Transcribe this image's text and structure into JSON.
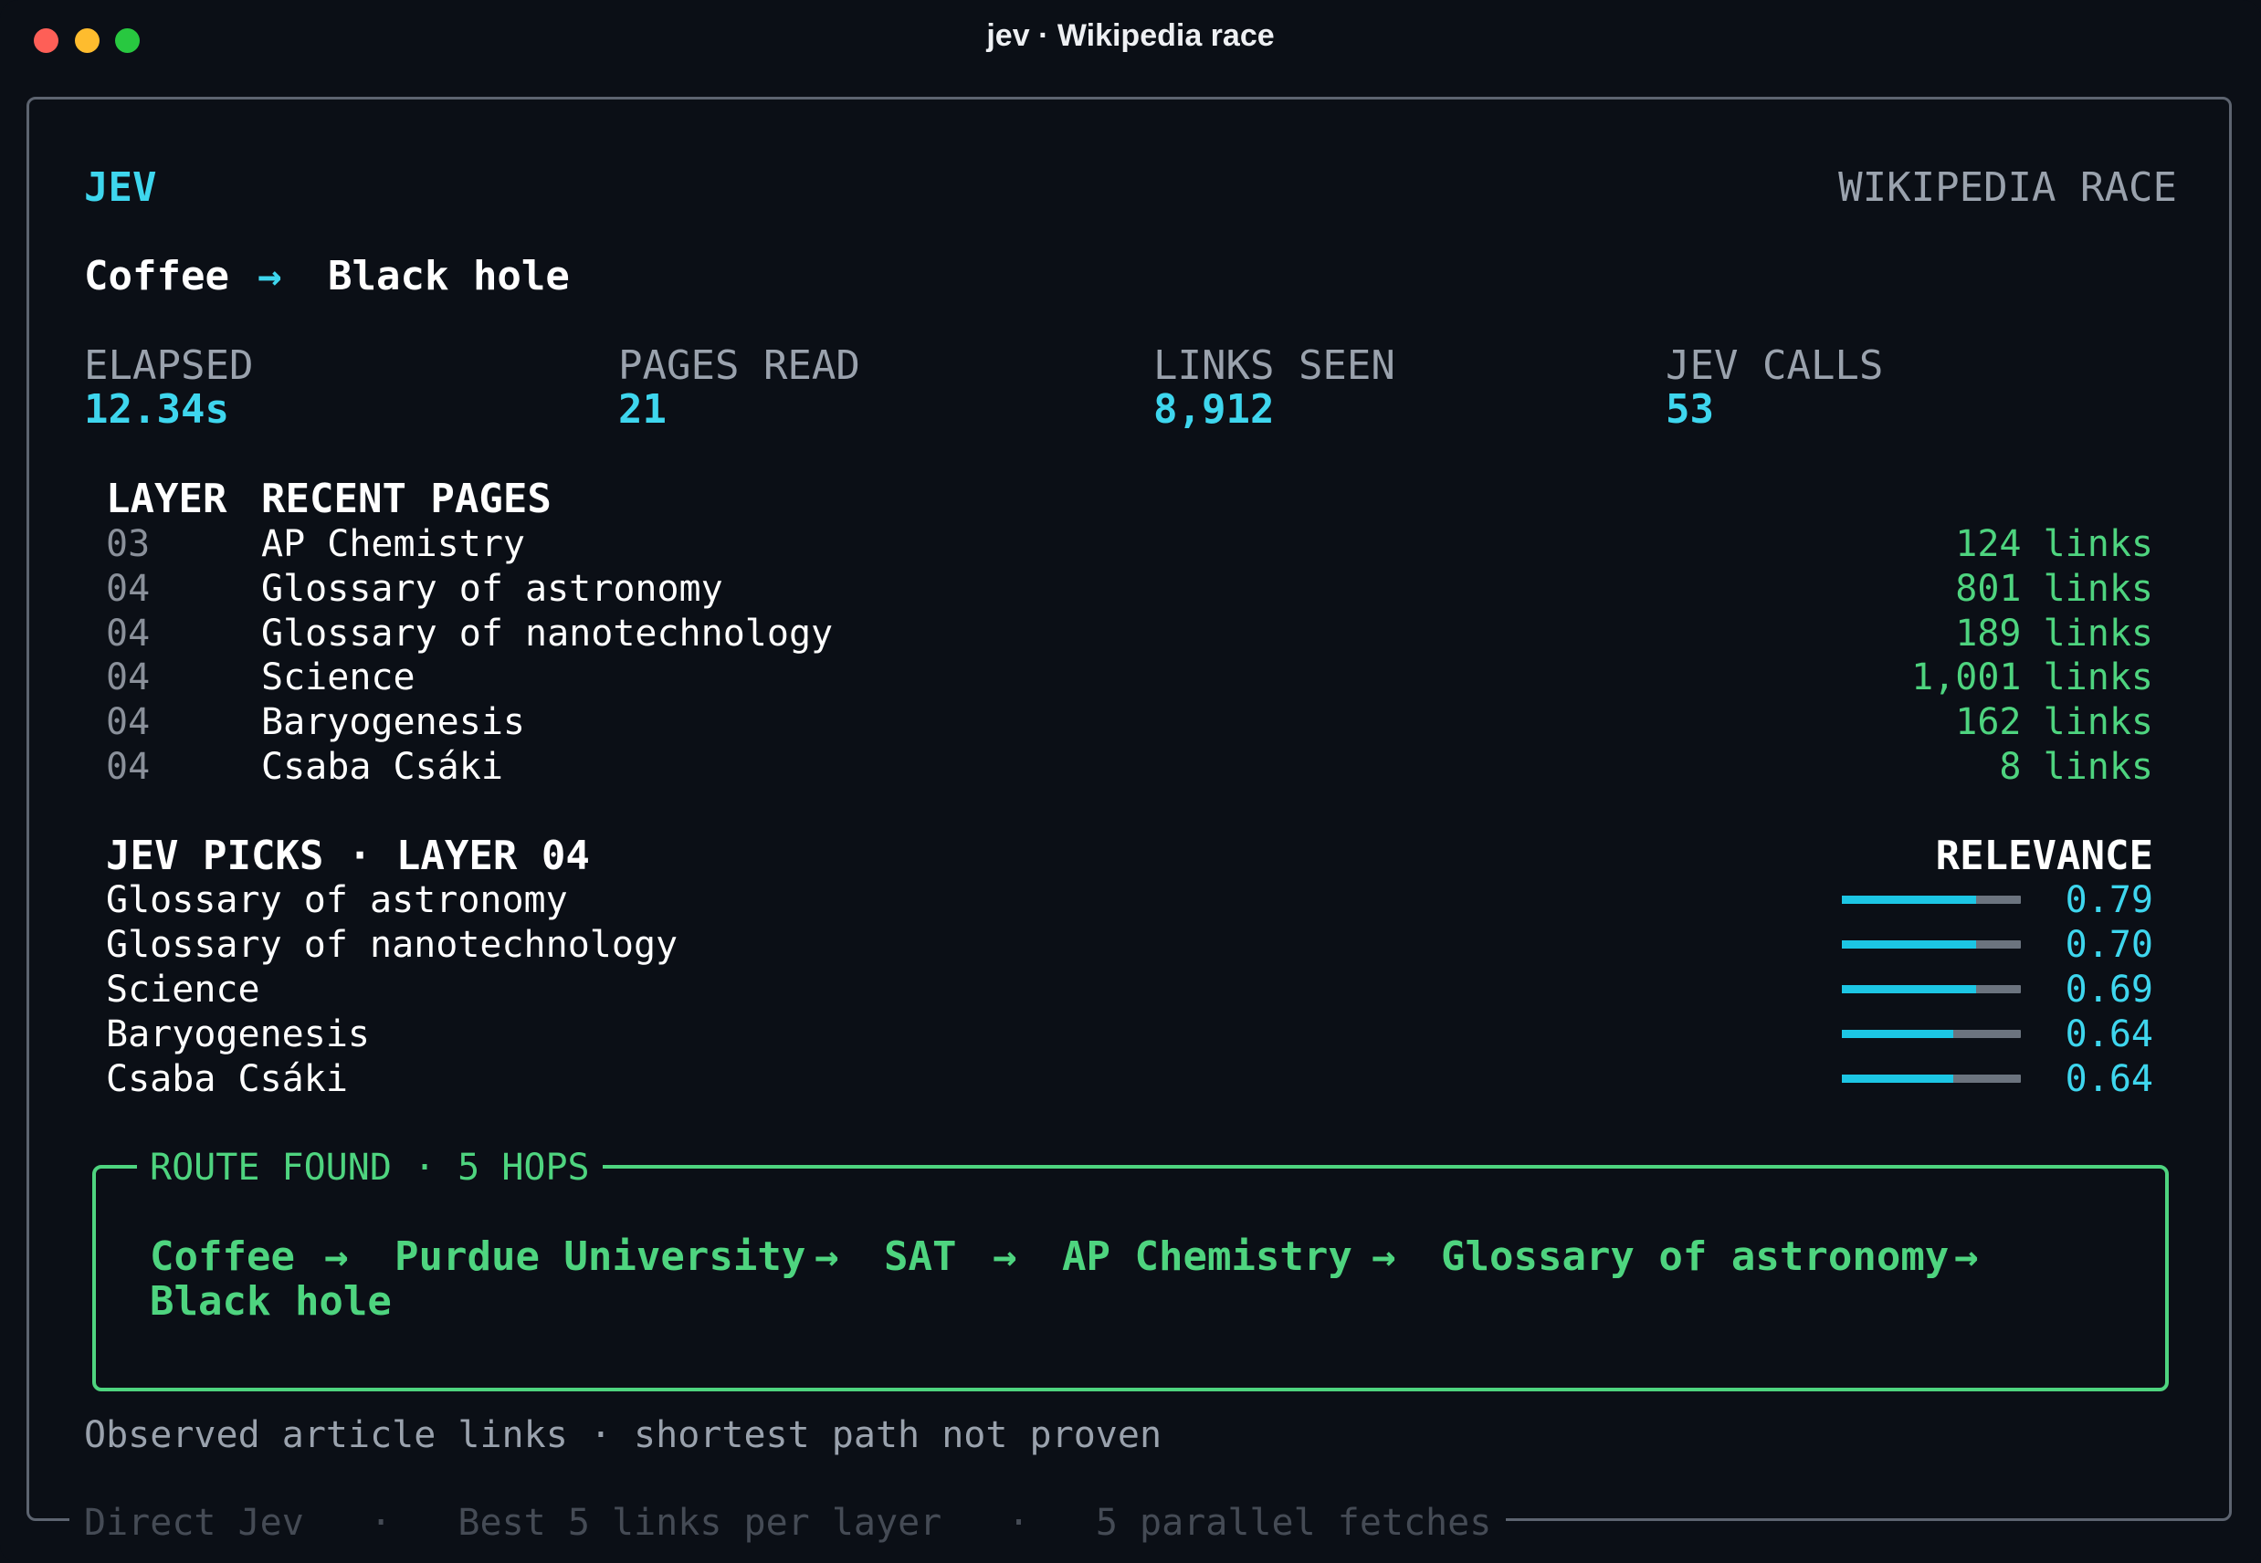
{
  "window": {
    "title": "jev · Wikipedia race"
  },
  "header": {
    "brand": "JEV",
    "mode": "WIKIPEDIA RACE"
  },
  "race": {
    "start": "Coffee",
    "arrow": "→",
    "target": "Black hole"
  },
  "stats": [
    {
      "label": "ELAPSED",
      "value": "12.34s"
    },
    {
      "label": "PAGES READ",
      "value": "21"
    },
    {
      "label": "LINKS SEEN",
      "value": "8,912"
    },
    {
      "label": "JEV CALLS",
      "value": "53"
    }
  ],
  "recent": {
    "layer_header": "LAYER",
    "pages_header": "RECENT PAGES",
    "rows": [
      {
        "layer": "03",
        "title": "AP Chemistry",
        "links": "124 links"
      },
      {
        "layer": "04",
        "title": "Glossary of astronomy",
        "links": "801 links"
      },
      {
        "layer": "04",
        "title": "Glossary of nanotechnology",
        "links": "189 links"
      },
      {
        "layer": "04",
        "title": "Science",
        "links": "1,001 links"
      },
      {
        "layer": "04",
        "title": "Baryogenesis",
        "links": "162 links"
      },
      {
        "layer": "04",
        "title": "Csaba Csáki",
        "links": "8 links"
      }
    ]
  },
  "picks": {
    "header": "JEV PICKS · LAYER 04",
    "relevance_header": "RELEVANCE",
    "rows": [
      {
        "title": "Glossary of astronomy",
        "relevance": "0.79",
        "fill": 0.75
      },
      {
        "title": "Glossary of nanotechnology",
        "relevance": "0.70",
        "fill": 0.75
      },
      {
        "title": "Science",
        "relevance": "0.69",
        "fill": 0.75
      },
      {
        "title": "Baryogenesis",
        "relevance": "0.64",
        "fill": 0.62
      },
      {
        "title": "Csaba Csáki",
        "relevance": "0.64",
        "fill": 0.62
      }
    ]
  },
  "route": {
    "legend": "ROUTE FOUND · 5 HOPS",
    "arrow": "→",
    "steps": [
      "Coffee",
      "Purdue University",
      "SAT",
      "AP Chemistry",
      "Glossary of astronomy",
      "Black hole"
    ]
  },
  "note": "Observed article links · shortest path not proven",
  "footer": {
    "mode": "Direct Jev",
    "sep": "·",
    "links_per_layer": "Best 5 links per layer",
    "fetches": "5 parallel fetches"
  },
  "colors": {
    "accent": "#3ed6ee",
    "success": "#4ed47f",
    "background": "#0b0f16"
  }
}
